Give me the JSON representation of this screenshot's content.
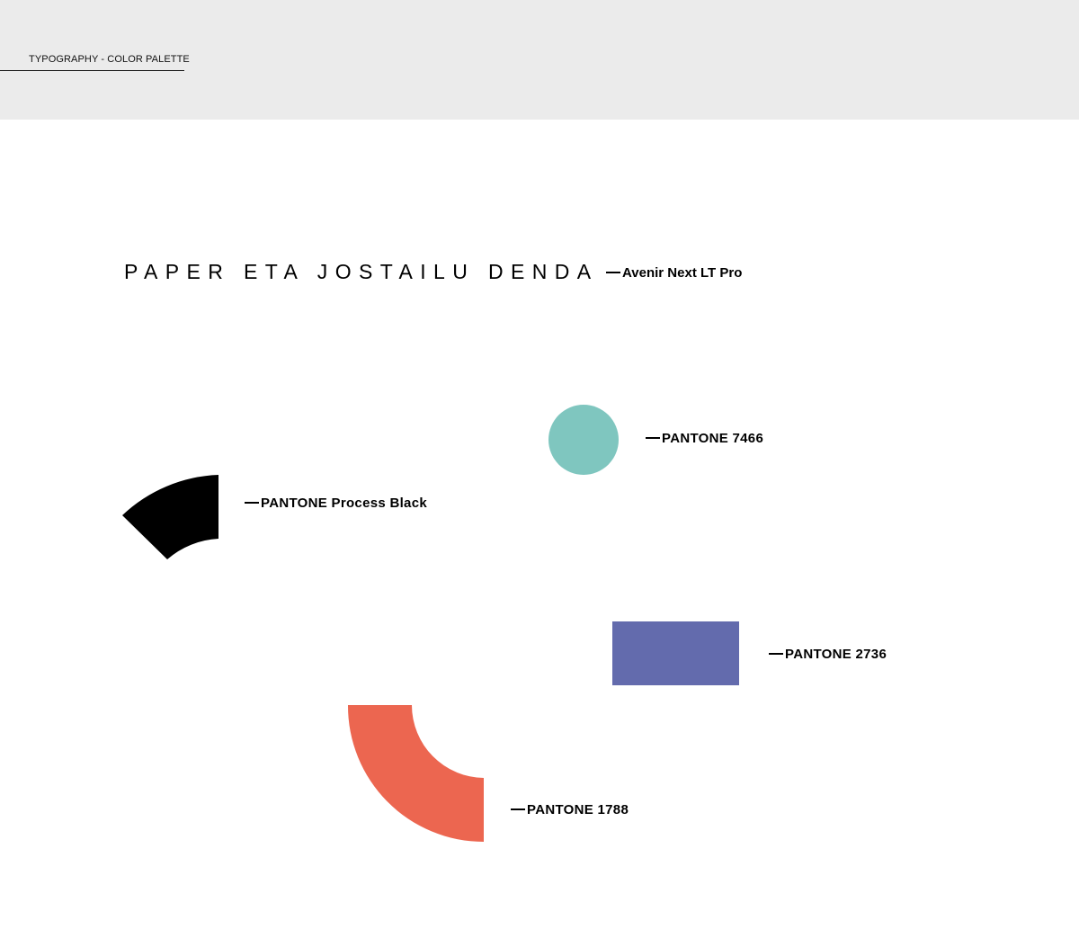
{
  "header": {
    "section_label": "TYPOGRAPHY - COLOR PALETTE"
  },
  "typography": {
    "sample_text": "PAPER ETA JOSTAILU DENDA",
    "font_label": "Avenir Next LT Pro"
  },
  "palette": {
    "process_black": {
      "label": "PANTONE Process Black",
      "color": "#000000",
      "shape": "quarter-ring"
    },
    "pantone_7466": {
      "label": "PANTONE 7466",
      "color": "#7fc6bf",
      "shape": "circle"
    },
    "pantone_2736": {
      "label": "PANTONE 2736",
      "color": "#636bad",
      "shape": "rectangle"
    },
    "pantone_1788": {
      "label": "PANTONE 1788",
      "color": "#ec6650",
      "shape": "quarter-ring"
    }
  }
}
